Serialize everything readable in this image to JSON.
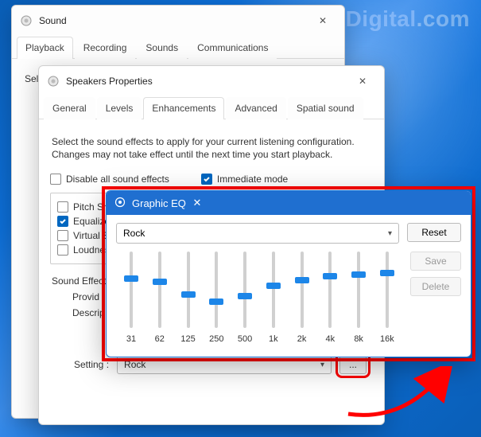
{
  "watermark": "WindowsDigital.com",
  "sound_window": {
    "title": "Sound",
    "tabs": [
      "Playback",
      "Recording",
      "Sounds",
      "Communications"
    ],
    "active_tab": "Playback",
    "hint_visible": "Sele"
  },
  "props_window": {
    "title": "Speakers Properties",
    "tabs": [
      "General",
      "Levels",
      "Enhancements",
      "Advanced",
      "Spatial sound"
    ],
    "active_tab": "Enhancements",
    "description": "Select the sound effects to apply for your current listening configuration. Changes may not take effect until the next time you start playback.",
    "disable_all_label": "Disable all sound effects",
    "disable_all_checked": false,
    "immediate_label": "Immediate mode",
    "immediate_checked": true,
    "effects": [
      {
        "label": "Pitch Shift",
        "checked": false
      },
      {
        "label": "Equalizer",
        "checked": true
      },
      {
        "label": "Virtual Sur",
        "checked": false
      },
      {
        "label": "Loudness",
        "checked": false
      }
    ],
    "section_label": "Sound Effect P",
    "provider_label": "Provid",
    "description_label": "Descrip",
    "setting_label": "Setting :",
    "setting_value": "Rock",
    "more_button": "..."
  },
  "eq_window": {
    "title": "Graphic EQ",
    "preset": "Rock",
    "reset_label": "Reset",
    "save_label": "Save",
    "delete_label": "Delete",
    "bands": [
      {
        "freq": "31",
        "pos": 35
      },
      {
        "freq": "62",
        "pos": 40
      },
      {
        "freq": "125",
        "pos": 56
      },
      {
        "freq": "250",
        "pos": 66
      },
      {
        "freq": "500",
        "pos": 58
      },
      {
        "freq": "1k",
        "pos": 45
      },
      {
        "freq": "2k",
        "pos": 38
      },
      {
        "freq": "4k",
        "pos": 32
      },
      {
        "freq": "8k",
        "pos": 30
      },
      {
        "freq": "16k",
        "pos": 28
      }
    ]
  }
}
